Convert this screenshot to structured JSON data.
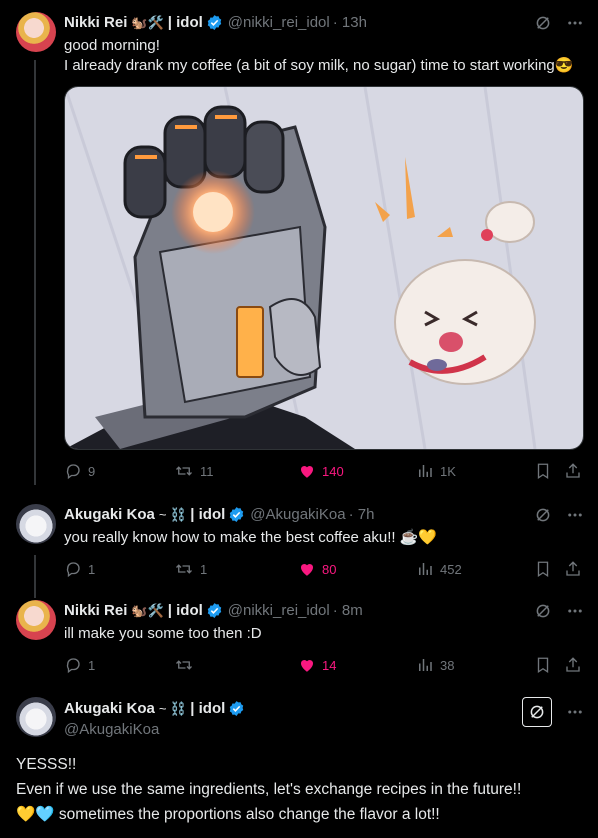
{
  "posts": [
    {
      "author": "Nikki Rei",
      "emoji": "🐿️🛠️",
      "tag": "| idol",
      "handle": "@nikki_rei_idol",
      "time": "· 13h",
      "text": "good morning!\nI already drank my coffee (a bit of soy milk, no sugar) time to start working😎",
      "replies": "9",
      "reposts": "11",
      "likes": "140",
      "views": "1K"
    },
    {
      "author": "Akugaki Koa",
      "emoji": "~ ⛓️",
      "tag": "| idol",
      "handle": "@AkugakiKoa",
      "time": "· 7h",
      "text": "you really know how to make the best coffee aku!! ☕💛",
      "replies": "1",
      "reposts": "1",
      "likes": "80",
      "views": "452"
    },
    {
      "author": "Nikki Rei",
      "emoji": "🐿️🛠️",
      "tag": "| idol",
      "handle": "@nikki_rei_idol",
      "time": "· 8m",
      "text": "ill make you some too then :D",
      "replies": "1",
      "reposts": "",
      "likes": "14",
      "views": "38"
    }
  ],
  "main": {
    "author": "Akugaki Koa",
    "emoji": "~ ⛓️",
    "tag": "| idol",
    "handle": "@AkugakiKoa",
    "line1": "YESSS!!",
    "line2": "Even if we use the same ingredients, let's exchange recipes in the future!!",
    "line3_emoji": "💛🩵",
    "line3": " sometimes the proportions also change the flavor a lot!!"
  },
  "colors": {
    "like": "#f91880",
    "verified": "#1d9bf0",
    "muted": "#71767b"
  },
  "icons": [
    "grok-icon",
    "more-icon",
    "reply-icon",
    "repost-icon",
    "heart-icon",
    "views-icon",
    "bookmark-icon",
    "share-icon",
    "verified-icon"
  ]
}
